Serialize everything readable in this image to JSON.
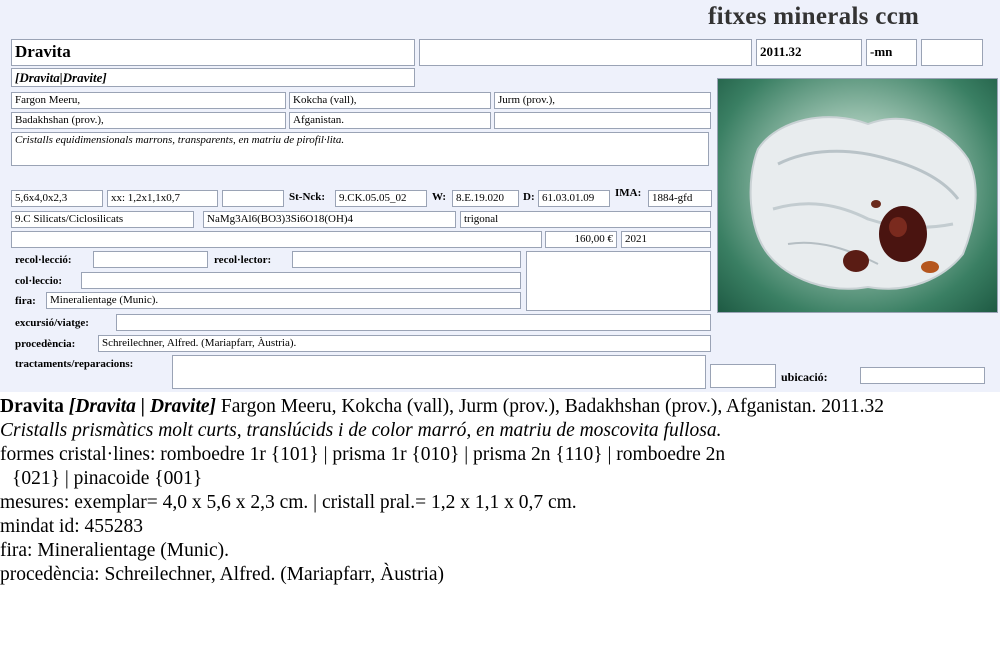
{
  "card": {
    "title": "fitxes minerals ccm",
    "name": "Dravita",
    "code": "2011.32",
    "suffix": "-mn",
    "synonyms": "[Dravita|Dravite]",
    "locality": [
      "Fargon Meeru,",
      "Kokcha (vall),",
      "Jurm (prov.),"
    ],
    "region": [
      "Badakhshan (prov.),",
      "Afganistan."
    ],
    "short_desc": "Cristalls equidimensionals marrons, transparents, en matriu de pirofil·lita.",
    "size": "5,6x4,0x2,3",
    "crystal_size": "xx: 1,2x1,1x0,7",
    "st_nck_label": "St-Nck:",
    "st_nck": "9.CK.05.05_02",
    "w_label": "W:",
    "w": "8.E.19.020",
    "d_label": "D:",
    "d": "61.03.01.09",
    "ima_label": "IMA:",
    "ima": "1884-gfd",
    "class": "9.C Silicats/Ciclosilicats",
    "formula": "NaMg3Al6(BO3)3Si6O18(OH)4",
    "system": "trigonal",
    "price": "160,00 €",
    "year": "2021",
    "recollection_label": "recol·lecció:",
    "collector_label": "recol·lector:",
    "collection_label": "col·leccio:",
    "fair_label": "fira:",
    "fair": "Mineralientage (Munic).",
    "trip_label": "excursió/viatge:",
    "origin_label": "procedència:",
    "origin": "Schreilechner, Alfred. (Mariapfarr, Àustria).",
    "treatments_label": "tractaments/reparacions:",
    "location_label": "ubicació:"
  },
  "description": {
    "name": "Dravita",
    "synonyms": "[Dravita | Dravite]",
    "locality": "Fargon Meeru, Kokcha (vall), Jurm (prov.), Badakhshan (prov.), Afganistan. 2011.32",
    "crystals": "Cristalls prismàtics molt curts, translúcids i de color marró, en matriu de moscovita fullosa.",
    "forms_1": "formes cristal·lines: romboedre 1r {101} | prisma 1r {010} | prisma 2n {110} | romboedre 2n",
    "forms_2": "{021} | pinacoide {001}",
    "measures": "mesures: exemplar= 4,0 x 5,6 x 2,3 cm. | cristall pral.= 1,2 x 1,1 x 0,7 cm.",
    "mindat": "mindat id: 455283",
    "fair": "fira: Mineralientage (Munic).",
    "origin": "procedència: Schreilechner, Alfred. (Mariapfarr, Àustria)"
  }
}
